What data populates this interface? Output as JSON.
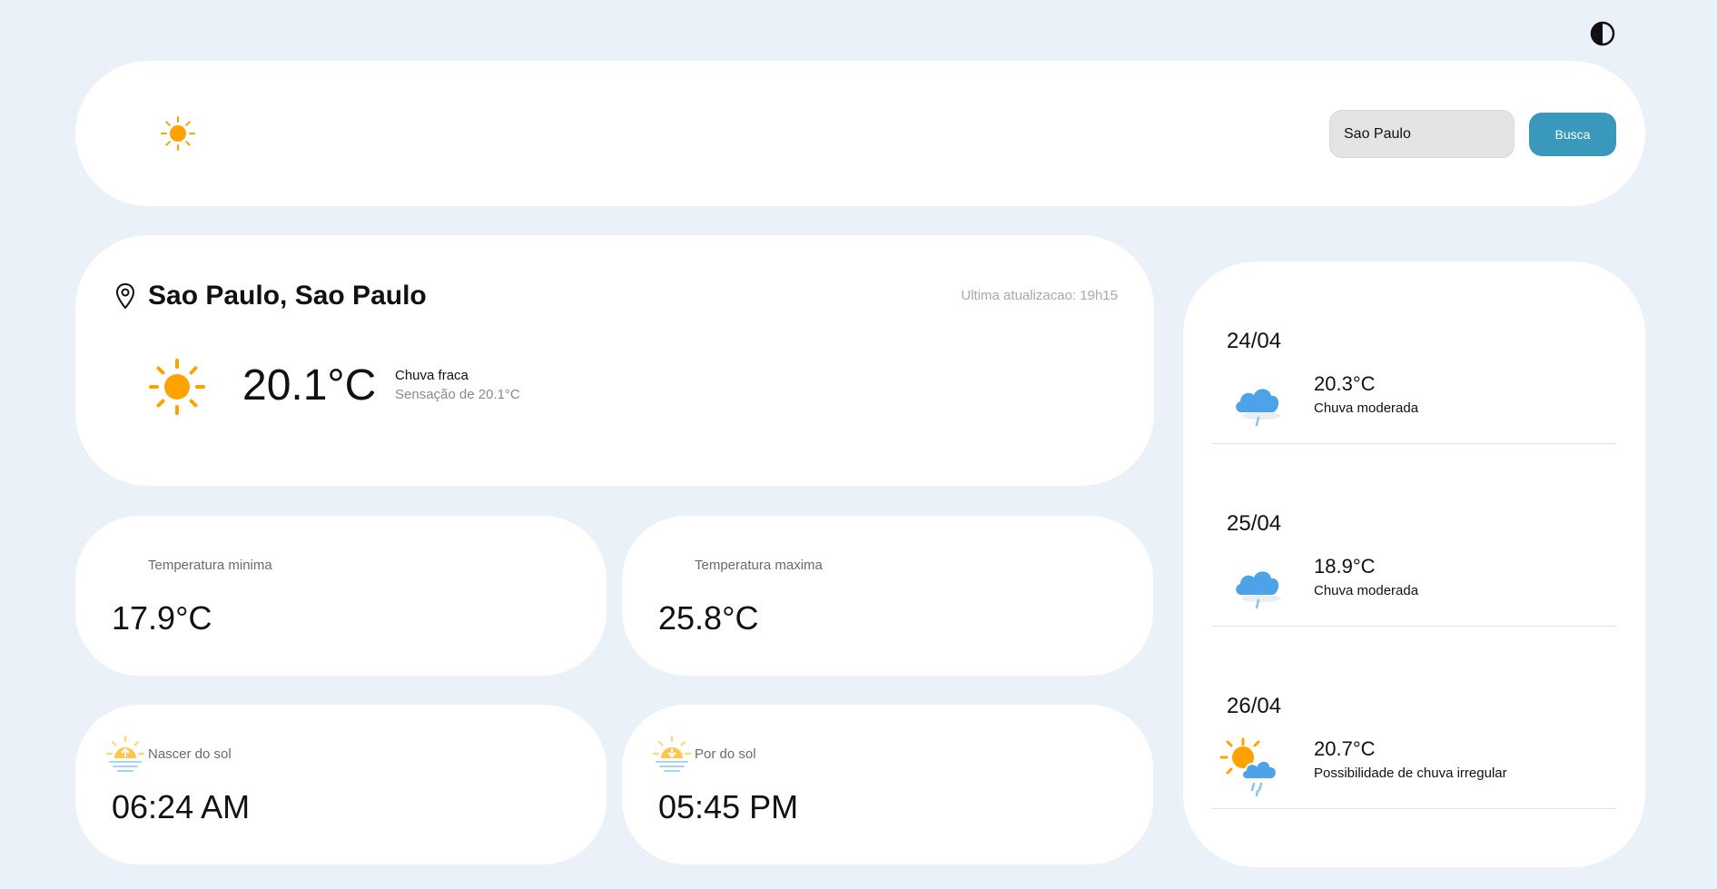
{
  "search": {
    "value": "Sao Paulo",
    "button_label": "Busca"
  },
  "current": {
    "location": "Sao Paulo, Sao Paulo",
    "last_update": "Ultima atualizacao: 19h15",
    "temperature": "20.1°C",
    "condition": "Chuva fraca",
    "feels_like": "Sensação de 20.1°C",
    "icon": "sun-icon"
  },
  "stats": {
    "min": {
      "label": "Temperatura minima",
      "value": "17.9°C"
    },
    "max": {
      "label": "Temperatura maxima",
      "value": "25.8°C"
    },
    "sunrise": {
      "label": "Nascer do sol",
      "value": "06:24 AM",
      "icon": "sunrise-icon"
    },
    "sunset": {
      "label": "Por do sol",
      "value": "05:45 PM",
      "icon": "sunset-icon"
    }
  },
  "forecast": [
    {
      "date": "24/04",
      "temperature": "20.3°C",
      "condition": "Chuva moderada",
      "icon": "rain-cloud-icon"
    },
    {
      "date": "25/04",
      "temperature": "18.9°C",
      "condition": "Chuva moderada",
      "icon": "rain-cloud-icon"
    },
    {
      "date": "26/04",
      "temperature": "20.7°C",
      "condition": "Possibilidade de chuva irregular",
      "icon": "sun-rain-cloud-icon"
    }
  ],
  "colors": {
    "background": "#eaf1f9",
    "accent": "#3a98bd",
    "sun": "#ffa200",
    "cloud": "#4ea3e8"
  }
}
